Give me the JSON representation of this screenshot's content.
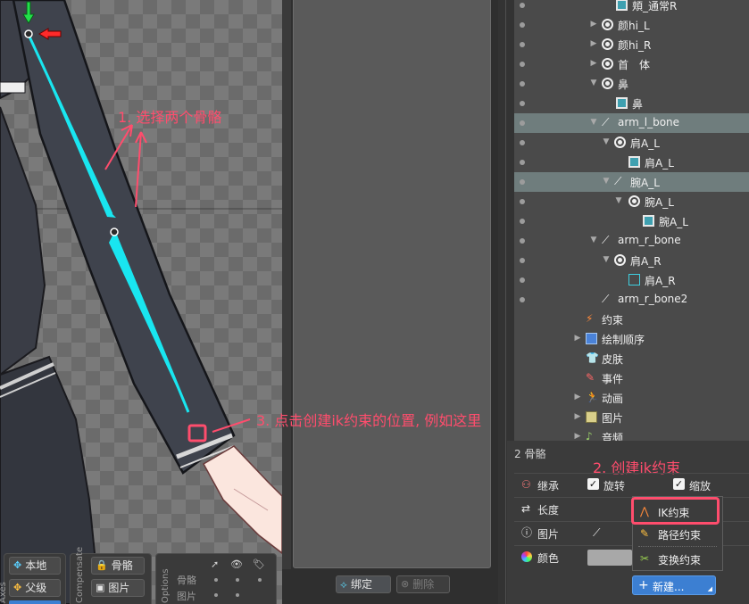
{
  "annotations": {
    "step1": "1. 选择两个骨骼",
    "step2": "2. 创建ik约束",
    "step3": "3. 点击创建ik约束的位置, 例如这里"
  },
  "viewport_toolbar": {
    "axes_label": "Axes",
    "local_label": "本地",
    "parent_label": "父级",
    "compensate_label": "Compensate",
    "bones_label": "骨骼",
    "images_label": "图片",
    "options_label": "Options",
    "options_bones_label": "骨骼",
    "options_images_label": "图片"
  },
  "bottom_buttons": {
    "bind_label": "绑定",
    "delete_label": "删除"
  },
  "tree": {
    "items": [
      {
        "label": "頬_通常R",
        "icon": "slot-icon"
      },
      {
        "label": "颜hi_L",
        "icon": "slot-circle-icon"
      },
      {
        "label": "颜hi_R",
        "icon": "slot-circle-icon"
      },
      {
        "label": "首　体",
        "icon": "slot-circle-icon"
      },
      {
        "label": "鼻",
        "icon": "slot-circle-icon"
      },
      {
        "label": "鼻",
        "icon": "slot-icon"
      },
      {
        "label": "arm_l_bone",
        "icon": "bone-icon"
      },
      {
        "label": "肩A_L",
        "icon": "slot-circle-icon"
      },
      {
        "label": "肩A_L",
        "icon": "slot-icon"
      },
      {
        "label": "腕A_L",
        "icon": "bone-icon"
      },
      {
        "label": "腕A_L",
        "icon": "slot-circle-icon"
      },
      {
        "label": "腕A_L",
        "icon": "slot-icon"
      },
      {
        "label": "arm_r_bone",
        "icon": "bone-icon"
      },
      {
        "label": "肩A_R",
        "icon": "slot-circle-icon"
      },
      {
        "label": "肩A_R",
        "icon": "mesh-icon"
      },
      {
        "label": "arm_r_bone2",
        "icon": "bone-icon"
      },
      {
        "label": "约束",
        "icon": "constraints-icon"
      },
      {
        "label": "绘制顺序",
        "icon": "draw-order-icon"
      },
      {
        "label": "皮肤",
        "icon": "skins-icon"
      },
      {
        "label": "事件",
        "icon": "events-icon"
      },
      {
        "label": "动画",
        "icon": "animations-icon"
      },
      {
        "label": "图片",
        "icon": "images-icon"
      },
      {
        "label": "音频",
        "icon": "audio-icon"
      }
    ]
  },
  "properties": {
    "header": "2 骨骼",
    "inherit_label": "继承",
    "rotate_label": "旋转",
    "scale_label": "缩放",
    "length_label": "长度",
    "image_label": "图片",
    "color_label": "颜色"
  },
  "menu": {
    "ik_label": "IK约束",
    "path_label": "路径约束",
    "transform_label": "变换约束"
  },
  "new_button": {
    "label": "新建..."
  },
  "colors": {
    "annotation": "#ff4d6d",
    "bone_cyan": "#19e6f0",
    "selection_row": "#6f7d7d",
    "new_button": "#3c7fd2"
  }
}
